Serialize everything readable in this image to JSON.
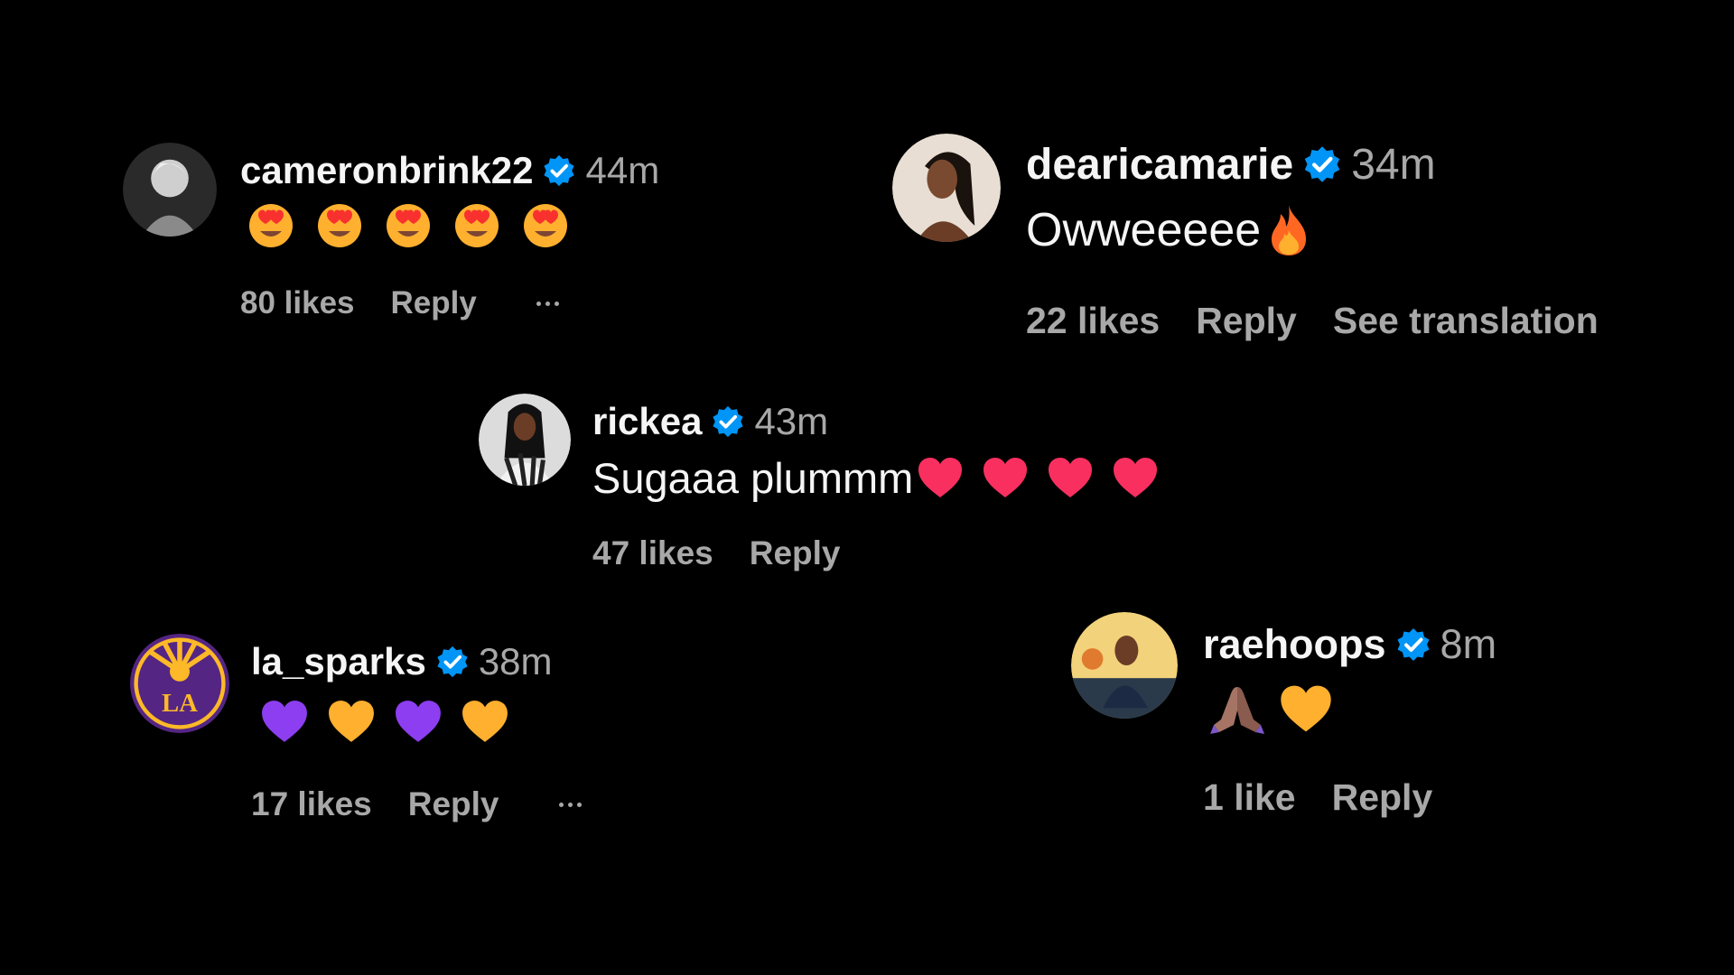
{
  "colors": {
    "background": "#000000",
    "primary_text": "#f5f5f5",
    "secondary_text": "#a8a8a8",
    "verified_badge": "#0095f6"
  },
  "comments": [
    {
      "username": "cameronbrink22",
      "verified": true,
      "time": "44m",
      "text": "",
      "emojis": [
        "smiling-face-with-heart-eyes",
        "smiling-face-with-heart-eyes",
        "smiling-face-with-heart-eyes",
        "smiling-face-with-heart-eyes",
        "smiling-face-with-heart-eyes"
      ],
      "likes": "80 likes",
      "reply": "Reply",
      "more_options": true
    },
    {
      "username": "dearicamarie",
      "verified": true,
      "time": "34m",
      "text": "Owweeeee",
      "emojis": [
        "fire"
      ],
      "likes": "22 likes",
      "reply": "Reply",
      "translation": "See translation"
    },
    {
      "username": "rickea",
      "verified": true,
      "time": "43m",
      "text": "Sugaaa plummm",
      "emojis": [
        "red-heart",
        "red-heart",
        "red-heart",
        "red-heart"
      ],
      "likes": "47 likes",
      "reply": "Reply"
    },
    {
      "username": "la_sparks",
      "verified": true,
      "time": "38m",
      "text": "",
      "emojis": [
        "purple-heart",
        "yellow-heart",
        "purple-heart",
        "yellow-heart"
      ],
      "likes": "17 likes",
      "reply": "Reply",
      "more_options": true
    },
    {
      "username": "raehoops",
      "verified": true,
      "time": "8m",
      "text": "",
      "emojis": [
        "folded-hands",
        "yellow-heart"
      ],
      "likes": "1 like",
      "reply": "Reply"
    }
  ]
}
